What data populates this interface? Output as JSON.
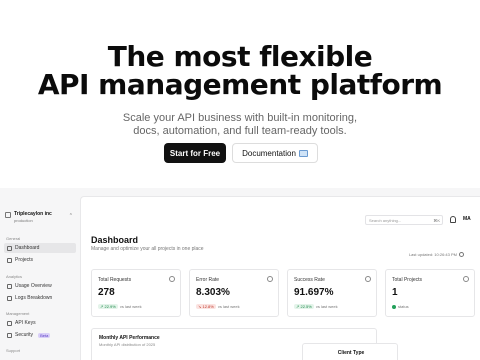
{
  "hero": {
    "title_line1": "The most  flexible",
    "title_line2": "API management platform",
    "subtitle_line1": "Scale your API business with built-in monitoring,",
    "subtitle_line2": "docs, automation, and full team-ready tools.",
    "cta_primary": "Start for Free",
    "cta_secondary": "Documentation"
  },
  "sidebar": {
    "org_name": "Triplecaylon inc",
    "org_env": "production",
    "sections": [
      {
        "label": "General",
        "items": [
          {
            "label": "Dashboard",
            "icon": "dashboard-icon"
          },
          {
            "label": "Projects",
            "icon": "folder-icon"
          }
        ]
      },
      {
        "label": "Analytics",
        "items": [
          {
            "label": "Usage Overview",
            "icon": "chart-icon"
          },
          {
            "label": "Logs Breakdown",
            "icon": "list-icon"
          }
        ]
      },
      {
        "label": "Management",
        "items": [
          {
            "label": "API Keys",
            "icon": "key-icon"
          },
          {
            "label": "Security",
            "icon": "shield-icon",
            "badge": "Beta"
          }
        ]
      },
      {
        "label": "Support",
        "items": []
      }
    ]
  },
  "topbar": {
    "search_placeholder": "Search anything...",
    "search_shortcut": "⌘K",
    "avatar_initials": "MA"
  },
  "dashboard": {
    "title": "Dashboard",
    "subtitle": "Manage and optimize your all projects in one place",
    "last_updated": "Last updated: 10:26:43 PM",
    "cards": [
      {
        "label": "Total Requests",
        "value": "278",
        "delta": "↗ 22.9%",
        "delta_dir": "up",
        "foot": "vs last week"
      },
      {
        "label": "Error Rate",
        "value": "8.303%",
        "delta": "↘ 12.8%",
        "delta_dir": "down",
        "foot": "vs last week"
      },
      {
        "label": "Success Rate",
        "value": "91.697%",
        "delta": "↗ 22.5%",
        "delta_dir": "up",
        "foot": "vs last week"
      },
      {
        "label": "Total Projects",
        "value": "1",
        "delta": "",
        "delta_dir": "none",
        "foot": "status"
      }
    ],
    "chart_panel": {
      "title": "Monthly API Performance",
      "subtitle": "Monthly API distribution of 2025"
    },
    "client_panel": {
      "title": "Client Type"
    }
  },
  "colors": {
    "primary_button": "#111111",
    "accent_purple": "#5b3fc4",
    "success": "#1f8a4c",
    "danger": "#c0392b"
  }
}
